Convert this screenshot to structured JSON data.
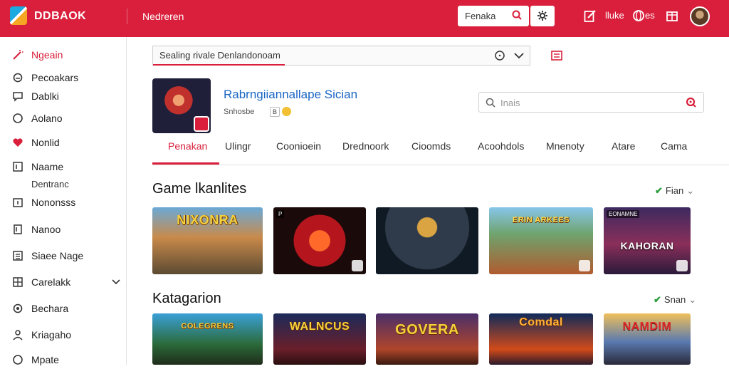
{
  "colors": {
    "accent": "#d91f3b",
    "link": "#1a66c4",
    "success": "#2a9d3a"
  },
  "topbar": {
    "brand": "DDBAOK",
    "section": "Nedreren",
    "search_text": "Fenaka",
    "icons": [
      "search-icon",
      "gear-icon",
      "edit-icon",
      "globe-icon",
      "gift-icon"
    ],
    "link1": "lluke",
    "link2": "es"
  },
  "sidebar": {
    "items": [
      {
        "label": "Ngeain",
        "icon": "magic-wand-icon"
      },
      {
        "label": "Pecoakars",
        "icon": "circle-icon"
      },
      {
        "label": "Dablki",
        "icon": "chat-icon"
      },
      {
        "label": "Aolano",
        "icon": "circle-icon"
      },
      {
        "label": "Nonlid",
        "icon": "heart-icon"
      },
      {
        "label": "Naame",
        "icon": "bracket-icon"
      },
      {
        "label": "Nononsss",
        "icon": "calendar-icon"
      },
      {
        "label": "Nanoo",
        "icon": "note-icon"
      },
      {
        "label": "Siaee Nage",
        "icon": "list-icon"
      },
      {
        "label": "Carelakk",
        "icon": "grid-icon"
      },
      {
        "label": "Bechara",
        "icon": "gear-icon"
      },
      {
        "label": "Kriagaho",
        "icon": "user-icon"
      },
      {
        "label": "Mpate",
        "icon": "circle-icon"
      }
    ],
    "sub_label": "Dentranc"
  },
  "main": {
    "search_value": "Sealing rivale Denlandonoam",
    "game": {
      "title": "Rabrngiiannallape Sician",
      "subtitle": "Snhosbe",
      "chip": "B",
      "search_placeholder": "Inais"
    },
    "tabs": [
      "Penakan",
      "Ulingr",
      "Coonioein",
      "Drednoork",
      "Cioomds",
      "Acoohdols",
      "Mnenoty",
      "Atare",
      "Cama"
    ],
    "sections": [
      {
        "title": "Game lkanlites",
        "action": "Fian",
        "cards": [
          {
            "caption": "NIXONRA"
          },
          {
            "caption": "",
            "tag": "P"
          },
          {
            "caption": ""
          },
          {
            "caption": "ERIN ARKEES",
            "tag": ""
          },
          {
            "caption": "KAHORAN",
            "tag": "EONAMNE"
          }
        ]
      },
      {
        "title": "Katagarion",
        "action": "Snan",
        "cards": [
          {
            "caption": "COLEGRENS"
          },
          {
            "caption": "WALNCUS"
          },
          {
            "caption": "GOVERA"
          },
          {
            "caption": "Comdal"
          },
          {
            "caption": "NAMDIM"
          }
        ]
      }
    ]
  }
}
